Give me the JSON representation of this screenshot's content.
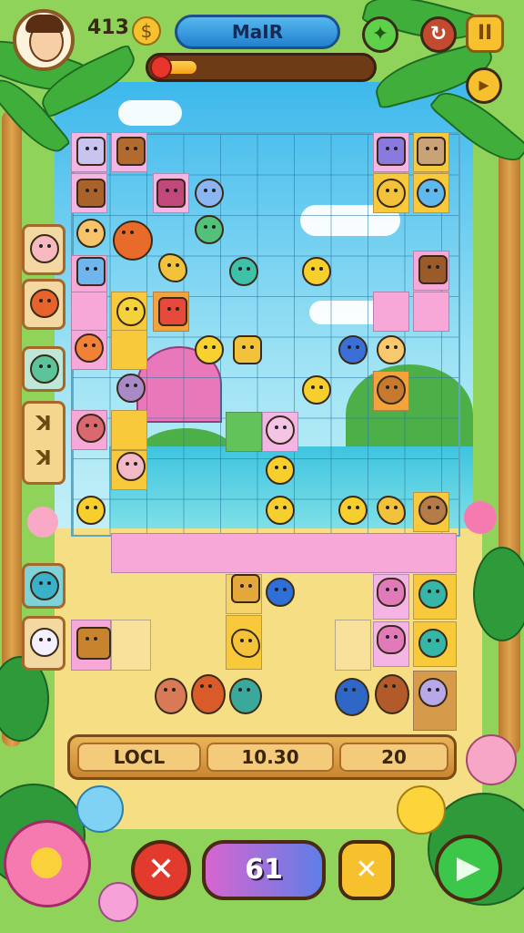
{
  "hud": {
    "coins": "413",
    "title": "MaIR",
    "progress_fraction": 0.18
  },
  "icons": {
    "coin": "coin-icon",
    "back": "refresh-icon",
    "pause": "pause-icon",
    "hint": "sparkle-icon",
    "play": "play-icon"
  },
  "sidebar": {
    "tile_text_1": "ꓘ",
    "tile_text_2": "ꓘ"
  },
  "infobar": {
    "label": "LOCL",
    "middle": "10.30",
    "right": "20"
  },
  "footer": {
    "center_value": "61"
  },
  "colors": {
    "title_blue": "#2380cf",
    "gold": "#f6c12e",
    "red_button": "#e23a2c",
    "purple_button": "#7e6fe3",
    "green_button": "#3cc64a"
  }
}
